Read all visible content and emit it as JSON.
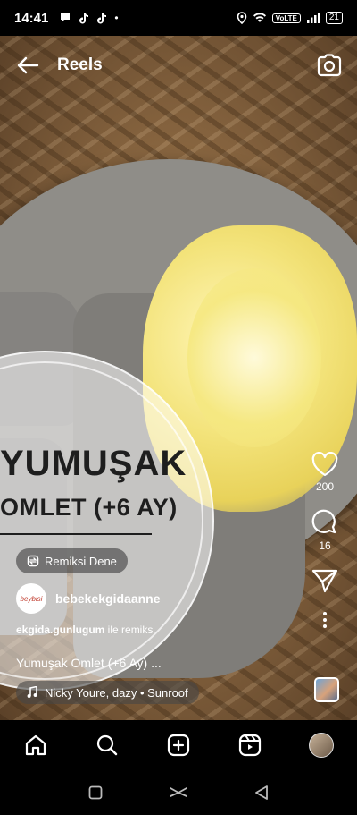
{
  "status_bar": {
    "time": "14:41",
    "dot": "•",
    "volte": "VoLTE",
    "battery": "21"
  },
  "header": {
    "title": "Reels"
  },
  "video": {
    "overlay_line1": "YUMUŞAK",
    "overlay_line2": "OMLET (+6 AY)"
  },
  "actions": {
    "likes": "200",
    "comments": "16"
  },
  "remix_button": {
    "label": "Remiksi Dene"
  },
  "author": {
    "avatar_text": "beybisi",
    "username": "bebekekgidaanne"
  },
  "remix_credit": {
    "user": "ekgida.gunlugum",
    "suffix": " ile remiks"
  },
  "caption": "Yumuşak Omlet (+6 Ay) ...",
  "music": {
    "label": "Nicky Youre, dazy • Sunroof"
  },
  "colors": {
    "background": "#000000",
    "overlay_text": "#1e1e1e",
    "plate": "#8f8d88"
  }
}
